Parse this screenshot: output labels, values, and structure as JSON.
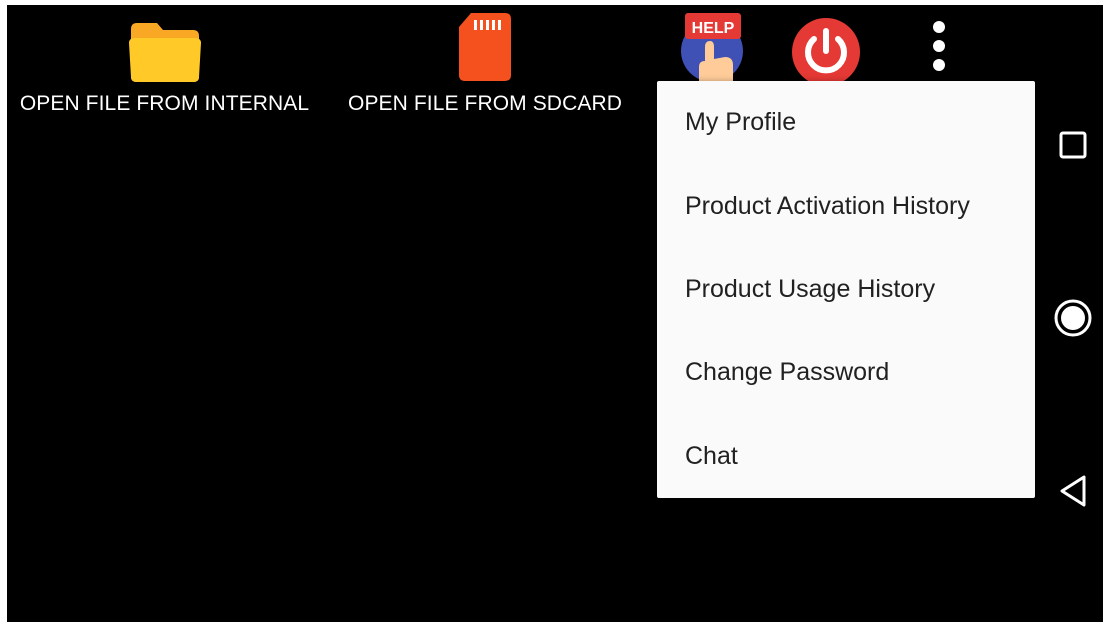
{
  "actions": {
    "internal": {
      "label": "OPEN FILE FROM INTERNAL",
      "icon": "folder-icon"
    },
    "sdcard": {
      "label": "OPEN FILE FROM SDCARD",
      "icon": "sd-card-icon"
    }
  },
  "toolbar": {
    "help_icon_text": "HELP",
    "help_icon": "help-icon",
    "power_icon": "power-icon",
    "overflow_icon": "more-vert-icon"
  },
  "menu": {
    "items": [
      {
        "label": "My Profile"
      },
      {
        "label": "Product Activation History"
      },
      {
        "label": "Product Usage History"
      },
      {
        "label": "Change Password"
      },
      {
        "label": "Chat"
      }
    ]
  },
  "nav": {
    "recents_icon": "recents-icon",
    "home_icon": "home-icon",
    "back_icon": "back-icon"
  },
  "colors": {
    "background": "#000000",
    "folder": "#fbc02d",
    "sdcard": "#f4511e",
    "power": "#e53935",
    "menu_bg": "#fafafa"
  }
}
